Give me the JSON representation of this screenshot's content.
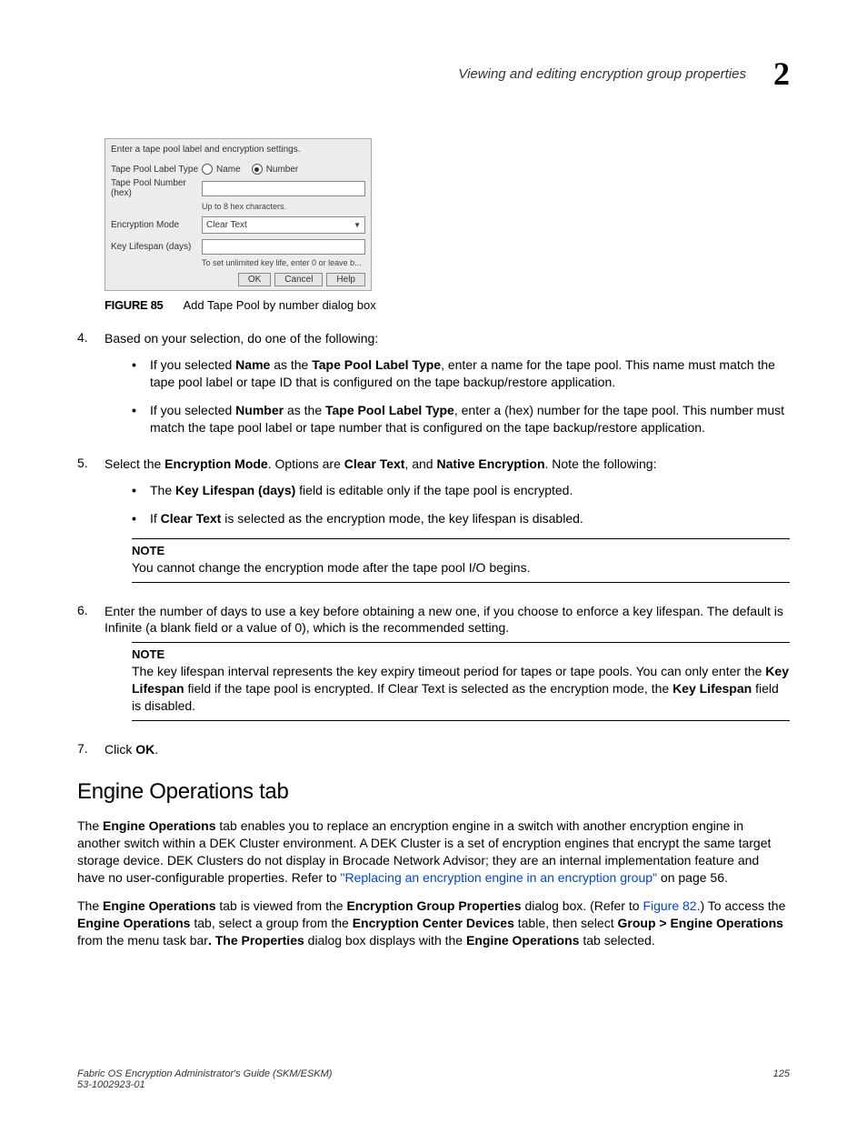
{
  "header": {
    "title": "Viewing and editing encryption group properties",
    "chapter": "2"
  },
  "dialog": {
    "instruction": "Enter a tape pool label and encryption settings.",
    "label_type": "Tape Pool Label Type",
    "radio_name": "Name",
    "radio_number": "Number",
    "number_label": "Tape Pool Number (hex)",
    "number_hint": "Up to 8 hex characters.",
    "mode_label": "Encryption Mode",
    "mode_value": "Clear Text",
    "lifespan_label": "Key Lifespan (days)",
    "lifespan_hint": "To set unlimited key life, enter 0 or leave b...",
    "btn_ok": "OK",
    "btn_cancel": "Cancel",
    "btn_help": "Help"
  },
  "figure": {
    "num": "FIGURE 85",
    "caption": "Add Tape Pool by number dialog box"
  },
  "steps": {
    "s4": {
      "num": "4.",
      "intro": "Based on your selection, do one of the following:",
      "b1_pre": "If you selected ",
      "b1_bold1": "Name",
      "b1_mid": " as the ",
      "b1_bold2": "Tape Pool Label Type",
      "b1_rest": ", enter a name for the tape pool. This name must match the tape pool label or tape ID that is configured on the tape backup/restore application.",
      "b2_pre": "If you selected ",
      "b2_bold1": "Number",
      "b2_mid": " as the ",
      "b2_bold2": "Tape Pool Label Type",
      "b2_rest": ", enter a (hex) number for the tape pool. This number must match the tape pool label or tape number that is configured on the tape backup/restore application."
    },
    "s5": {
      "num": "5.",
      "p1_a": "Select the ",
      "p1_b": "Encryption Mode",
      "p1_c": ". Options are ",
      "p1_d": "Clear Text",
      "p1_e": ", and ",
      "p1_f": "Native Encryption",
      "p1_g": ". Note the following:",
      "b1_a": "The ",
      "b1_b": "Key Lifespan (days)",
      "b1_c": " field is editable only if the tape pool is encrypted.",
      "b2_a": "If ",
      "b2_b": "Clear Text",
      "b2_c": " is selected as the encryption mode, the key lifespan is disabled.",
      "note_label": "NOTE",
      "note_text": "You cannot change the encryption mode after the tape pool I/O begins."
    },
    "s6": {
      "num": "6.",
      "text": "Enter the number of days to use a key before obtaining a new one, if you choose to enforce a key lifespan. The default is Infinite (a blank field or a value of 0), which is the recommended setting.",
      "note_label": "NOTE",
      "note_a": "The key lifespan interval represents the key expiry timeout period for tapes or tape pools. You can only enter the ",
      "note_b": "Key Lifespan",
      "note_c": " field if the tape pool is encrypted. If Clear Text is selected as the encryption mode, the ",
      "note_d": "Key Lifespan",
      "note_e": " field is disabled."
    },
    "s7": {
      "num": "7.",
      "a": "Click ",
      "b": "OK",
      "c": "."
    }
  },
  "section": {
    "title": "Engine Operations tab",
    "p1_a": "The ",
    "p1_b": "Engine Operations",
    "p1_c": " tab enables you to replace an encryption engine in a switch with another encryption engine in another switch within a DEK Cluster environment. A DEK Cluster is a set of encryption engines that encrypt the same target storage device. DEK Clusters do not display in Brocade Network Advisor; they are an internal implementation feature and have no user-configurable properties. Refer to ",
    "p1_link": "\"Replacing an encryption engine in an encryption group\"",
    "p1_d": " on page 56.",
    "p2_a": "The ",
    "p2_b": "Engine Operations",
    "p2_c": " tab is viewed from the ",
    "p2_d": "Encryption Group Properties",
    "p2_e": " dialog box. (Refer to ",
    "p2_link": "Figure 82",
    "p2_f": ".) To access the ",
    "p2_g": "Engine Operations",
    "p2_h": " tab, select a group from the ",
    "p2_i": "Encryption Center Devices",
    "p2_j": " table, then select ",
    "p2_k": "Group > Engine Operations",
    "p2_l": " from the menu task bar",
    "p2_m": ". The ",
    "p2_n": "Properties",
    "p2_o": " dialog box displays with the ",
    "p2_p": "Engine Operations",
    "p2_q": " tab selected."
  },
  "footer": {
    "left1": "Fabric OS Encryption Administrator's Guide (SKM/ESKM)",
    "left2": "53-1002923-01",
    "right": "125"
  }
}
